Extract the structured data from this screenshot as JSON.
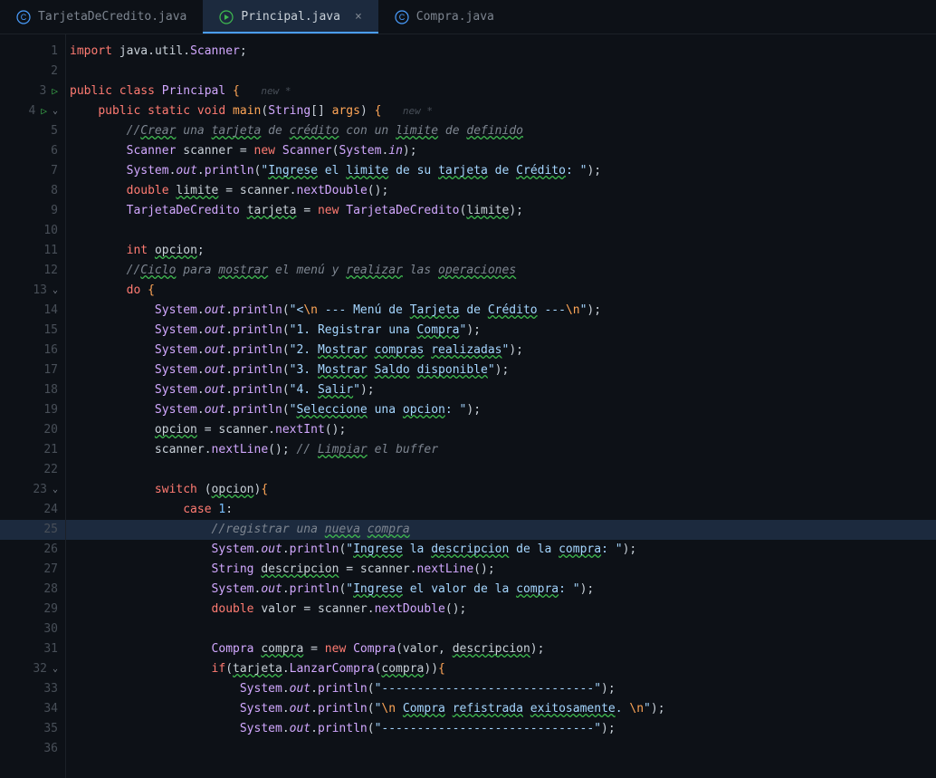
{
  "tabs": [
    {
      "name": "TarjetaDeCredito.java",
      "active": false
    },
    {
      "name": "Principal.java",
      "active": true
    },
    {
      "name": "Compra.java",
      "active": false
    }
  ],
  "currentLine": 25,
  "code": {
    "lines": [
      {
        "n": 1,
        "html": "<span class='kw'>import</span> <span class='var'>java</span>.<span class='var'>util</span>.<span class='cls'>Scanner</span>;"
      },
      {
        "n": 2,
        "html": ""
      },
      {
        "n": 3,
        "run": true,
        "html": "<span class='kw'>public</span> <span class='kw'>class</span> <span class='cls'>Principal</span> <span class='brace'>{</span>   <span class='hint'>new *</span>"
      },
      {
        "n": 4,
        "run": true,
        "fold": true,
        "html": "    <span class='kw'>public</span> <span class='kw'>static</span> <span class='kw'>void</span> <span class='fn'>main</span><span class='paren'>(</span><span class='cls'>String</span><span class='paren'>[]</span> <span class='param'>args</span><span class='paren'>)</span> <span class='brace'>{</span>   <span class='hint'>new *</span>"
      },
      {
        "n": 5,
        "html": "        <span class='com'>//<span class='wavy'>Crear</span> una <span class='wavy'>tarjeta</span> de <span class='wavy'>crédito</span> con un <span class='wavy'>limite</span> de <span class='wavy'>definido</span></span>"
      },
      {
        "n": 6,
        "html": "        <span class='cls'>Scanner</span> <span class='var'>scanner</span> <span class='op'>=</span> <span class='kw'>new</span> <span class='cls'>Scanner</span><span class='paren'>(</span><span class='cls'>System</span>.<span class='field'>in</span><span class='paren'>)</span>;"
      },
      {
        "n": 7,
        "html": "        <span class='cls'>System</span>.<span class='field'>out</span>.<span class='method'>println</span><span class='paren'>(</span><span class='str'>\"<span class='wavy'>Ingrese</span> el <span class='wavy'>limite</span> de su <span class='wavy'>tarjeta</span> de <span class='wavy'>Crédito</span>: \"</span><span class='paren'>)</span>;"
      },
      {
        "n": 8,
        "html": "        <span class='kw'>double</span> <span class='var wavy'>limite</span> <span class='op'>=</span> <span class='var'>scanner</span>.<span class='method'>nextDouble</span><span class='paren'>()</span>;"
      },
      {
        "n": 9,
        "html": "        <span class='cls'>TarjetaDeCredito</span> <span class='var wavy'>tarjeta</span> <span class='op'>=</span> <span class='kw'>new</span> <span class='cls'>TarjetaDeCredito</span><span class='paren'>(</span><span class='var wavy'>limite</span><span class='paren'>)</span>;"
      },
      {
        "n": 10,
        "html": ""
      },
      {
        "n": 11,
        "html": "        <span class='kw'>int</span> <span class='var wavy'>opcion</span>;"
      },
      {
        "n": 12,
        "html": "        <span class='com'>//<span class='wavy'>Ciclo</span> para <span class='wavy'>mostrar</span> el menú y <span class='wavy'>realizar</span> las <span class='wavy'>operaciones</span></span>"
      },
      {
        "n": 13,
        "fold": true,
        "html": "        <span class='kw'>do</span> <span class='brace'>{</span>"
      },
      {
        "n": 14,
        "html": "            <span class='cls'>System</span>.<span class='field'>out</span>.<span class='method'>println</span><span class='paren'>(</span><span class='str'>\"&lt;<span class='str-esc'>\\n</span> --- Menú de <span class='wavy'>Tarjeta</span> de <span class='wavy'>Crédito</span> ---<span class='str-esc'>\\n</span>\"</span><span class='paren'>)</span>;"
      },
      {
        "n": 15,
        "html": "            <span class='cls'>System</span>.<span class='field'>out</span>.<span class='method'>println</span><span class='paren'>(</span><span class='str'>\"1. Registrar una <span class='wavy'>Compra</span>\"</span><span class='paren'>)</span>;"
      },
      {
        "n": 16,
        "html": "            <span class='cls'>System</span>.<span class='field'>out</span>.<span class='method'>println</span><span class='paren'>(</span><span class='str'>\"2. <span class='wavy'>Mostrar</span> <span class='wavy'>compras</span> <span class='wavy'>realizadas</span>\"</span><span class='paren'>)</span>;"
      },
      {
        "n": 17,
        "html": "            <span class='cls'>System</span>.<span class='field'>out</span>.<span class='method'>println</span><span class='paren'>(</span><span class='str'>\"3. <span class='wavy'>Mostrar</span> <span class='wavy'>Saldo</span> <span class='wavy'>disponible</span>\"</span><span class='paren'>)</span>;"
      },
      {
        "n": 18,
        "html": "            <span class='cls'>System</span>.<span class='field'>out</span>.<span class='method'>println</span><span class='paren'>(</span><span class='str'>\"4. <span class='wavy'>Salir</span>\"</span><span class='paren'>)</span>;"
      },
      {
        "n": 19,
        "html": "            <span class='cls'>System</span>.<span class='field'>out</span>.<span class='method'>println</span><span class='paren'>(</span><span class='str'>\"<span class='wavy'>Seleccione</span> una <span class='wavy'>opcion</span>: \"</span><span class='paren'>)</span>;"
      },
      {
        "n": 20,
        "html": "            <span class='var wavy'>opcion</span> <span class='op'>=</span> <span class='var'>scanner</span>.<span class='method'>nextInt</span><span class='paren'>()</span>;"
      },
      {
        "n": 21,
        "html": "            <span class='var'>scanner</span>.<span class='method'>nextLine</span><span class='paren'>()</span>; <span class='com'>// <span class='wavy'>Limpiar</span> el buffer</span>"
      },
      {
        "n": 22,
        "html": ""
      },
      {
        "n": 23,
        "fold": true,
        "html": "            <span class='kw'>switch</span> <span class='paren'>(</span><span class='var wavy'>opcion</span><span class='paren'>)</span><span class='brace'>{</span>"
      },
      {
        "n": 24,
        "html": "                <span class='kw'>case</span> <span class='num'>1</span>:"
      },
      {
        "n": 25,
        "current": true,
        "html": "                    <span class='com'>//registrar una <span class='wavy'>nueva</span> <span class='wavy'>compra</span></span>"
      },
      {
        "n": 26,
        "html": "                    <span class='cls'>System</span>.<span class='field'>out</span>.<span class='method'>println</span><span class='paren'>(</span><span class='str'>\"<span class='wavy'>Ingrese</span> la <span class='wavy'>descripcion</span> de la <span class='wavy'>compra</span>: \"</span><span class='paren'>)</span>;"
      },
      {
        "n": 27,
        "html": "                    <span class='cls'>String</span> <span class='var wavy'>descripcion</span> <span class='op'>=</span> <span class='var'>scanner</span>.<span class='method'>nextLine</span><span class='paren'>()</span>;"
      },
      {
        "n": 28,
        "html": "                    <span class='cls'>System</span>.<span class='field'>out</span>.<span class='method'>println</span><span class='paren'>(</span><span class='str'>\"<span class='wavy'>Ingrese</span> el valor de la <span class='wavy'>compra</span>: \"</span><span class='paren'>)</span>;"
      },
      {
        "n": 29,
        "html": "                    <span class='kw'>double</span> <span class='var'>valor</span> <span class='op'>=</span> <span class='var'>scanner</span>.<span class='method'>nextDouble</span><span class='paren'>()</span>;"
      },
      {
        "n": 30,
        "html": ""
      },
      {
        "n": 31,
        "html": "                    <span class='cls'>Compra</span> <span class='var wavy'>compra</span> <span class='op'>=</span> <span class='kw'>new</span> <span class='cls'>Compra</span><span class='paren'>(</span><span class='var'>valor</span>, <span class='var wavy'>descripcion</span><span class='paren'>)</span>;"
      },
      {
        "n": 32,
        "fold": true,
        "html": "                    <span class='kw'>if</span><span class='paren'>(</span><span class='var wavy'>tarjeta</span>.<span class='method'>LanzarCompra</span><span class='paren'>(</span><span class='var wavy'>compra</span><span class='paren'>))</span><span class='brace'>{</span>"
      },
      {
        "n": 33,
        "html": "                        <span class='cls'>System</span>.<span class='field'>out</span>.<span class='method'>println</span><span class='paren'>(</span><span class='str'>\"------------------------------\"</span><span class='paren'>)</span>;"
      },
      {
        "n": 34,
        "html": "                        <span class='cls'>System</span>.<span class='field'>out</span>.<span class='method'>println</span><span class='paren'>(</span><span class='str'>\"<span class='str-esc'>\\n</span> <span class='wavy'>Compra</span> <span class='wavy'>refistrada</span> <span class='wavy'>exitosamente</span>. <span class='str-esc'>\\n</span>\"</span><span class='paren'>)</span>;"
      },
      {
        "n": 35,
        "html": "                        <span class='cls'>System</span>.<span class='field'>out</span>.<span class='method'>println</span><span class='paren'>(</span><span class='str'>\"------------------------------\"</span><span class='paren'>)</span>;"
      },
      {
        "n": 36,
        "html": ""
      }
    ]
  }
}
